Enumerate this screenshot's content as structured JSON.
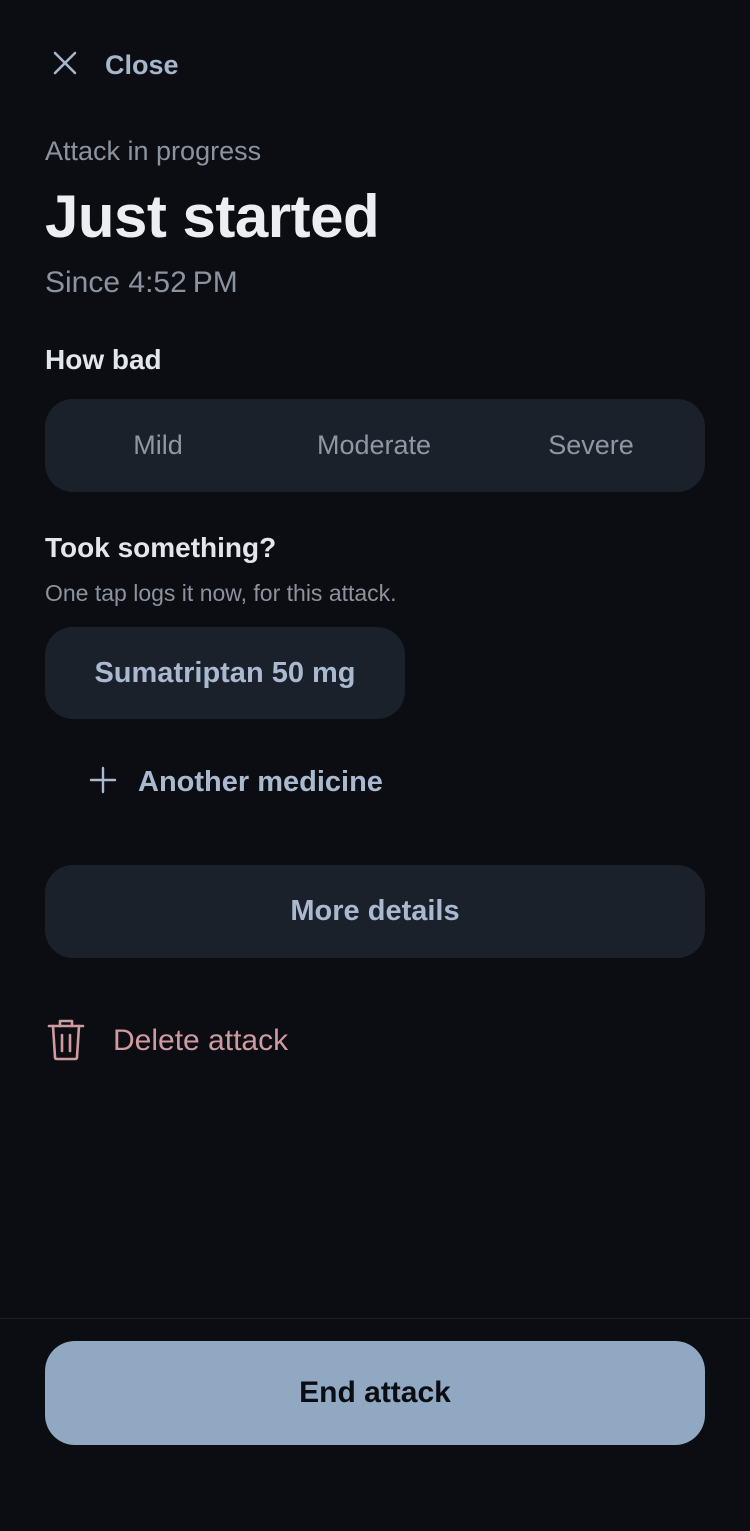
{
  "header": {
    "close_label": "Close",
    "close_icon": "close-icon"
  },
  "status": {
    "kicker": "Attack in progress",
    "title": "Just started",
    "since": "Since 4:52 PM"
  },
  "severity": {
    "label": "How bad",
    "options": [
      "Mild",
      "Moderate",
      "Severe"
    ]
  },
  "medication": {
    "label": "Took something?",
    "hint": "One tap logs it now, for this attack.",
    "quick_chip": "Sumatriptan 50 mg",
    "add_label": "Another medicine",
    "add_icon": "plus-icon"
  },
  "actions": {
    "more_details": "More details",
    "delete_label": "Delete attack",
    "delete_icon": "trash-icon",
    "end_label": "End attack"
  },
  "colors": {
    "background": "#0b0d12",
    "surface": "#1b212b",
    "accent": "#91a8c2",
    "accent_text": "#a9bad0",
    "danger": "#cf9aa0",
    "muted": "#8c939e"
  }
}
